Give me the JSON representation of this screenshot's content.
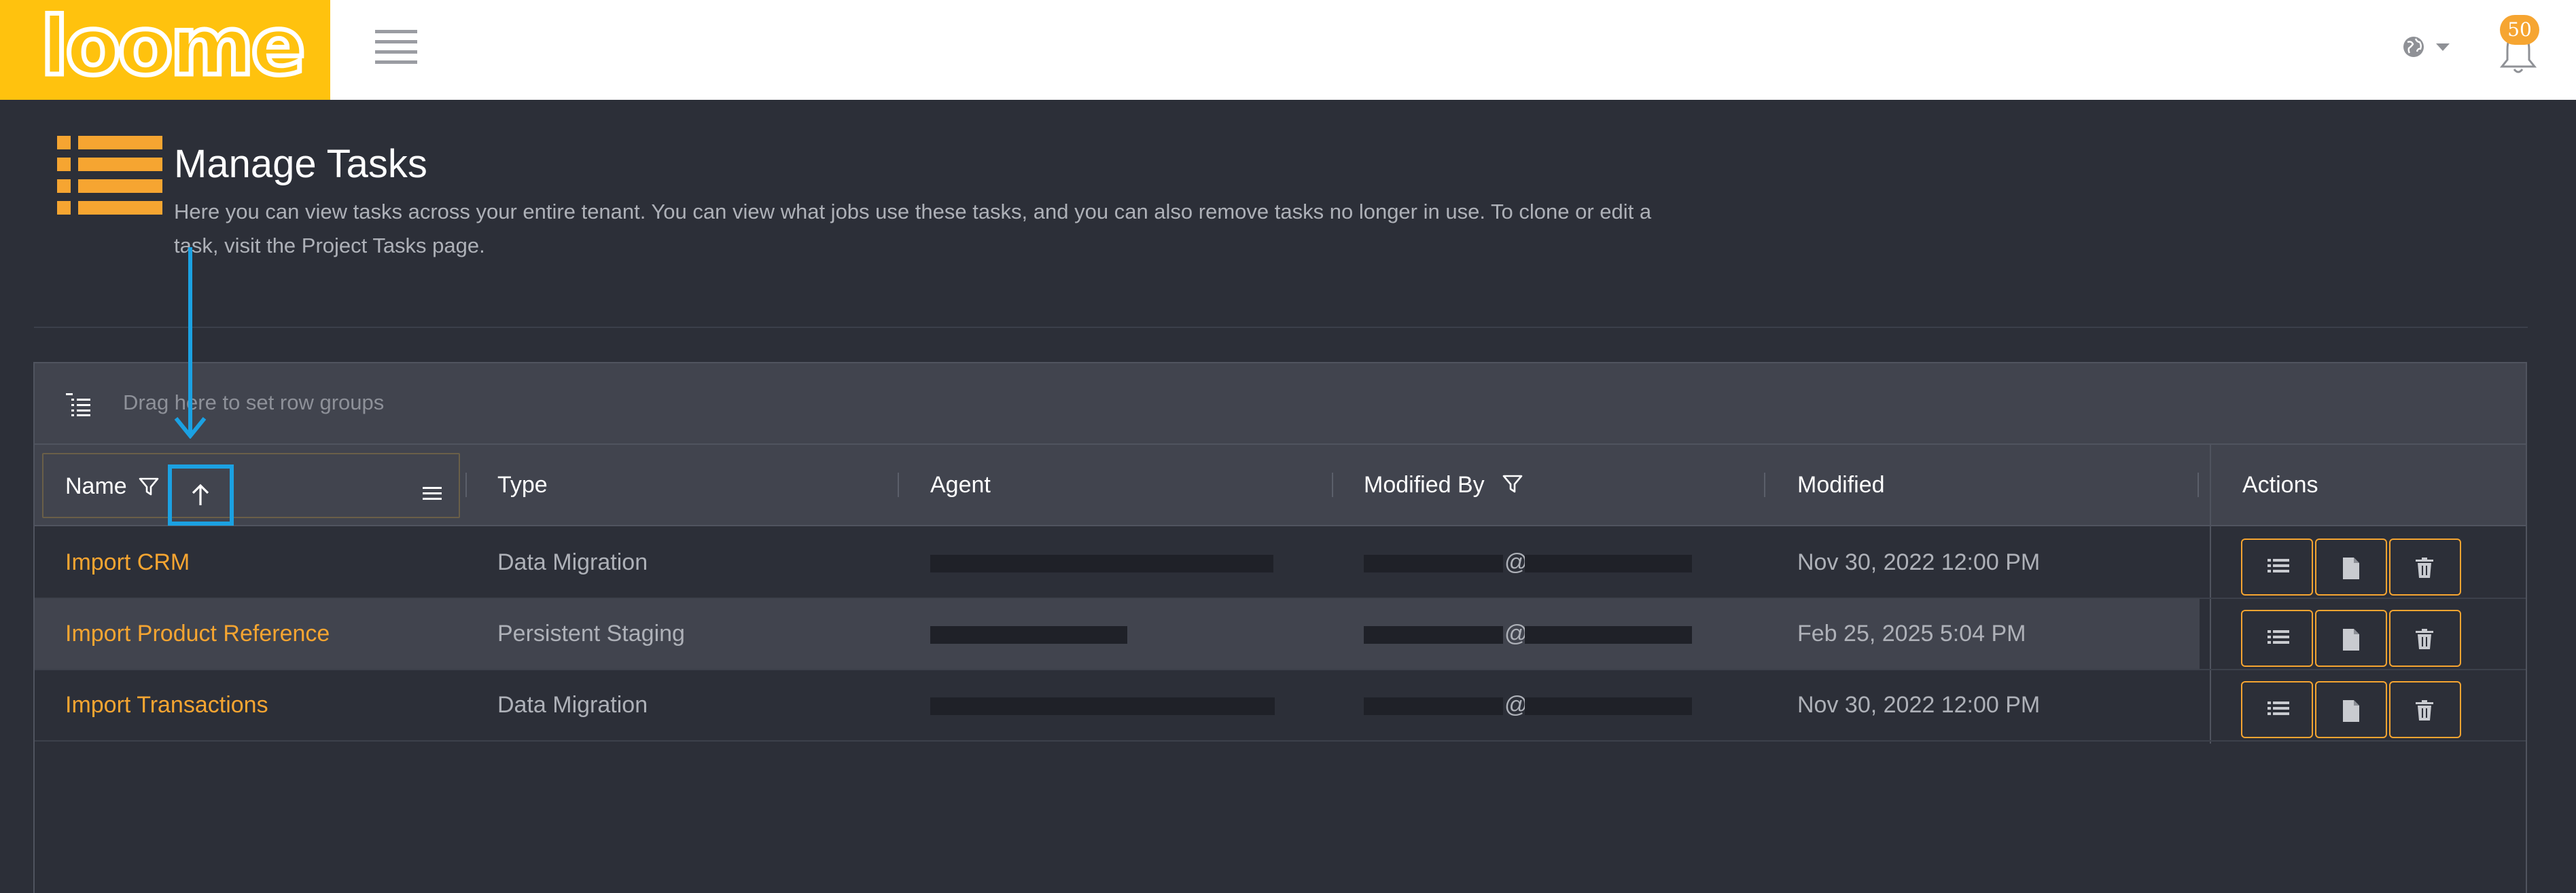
{
  "header": {
    "logo_text": "loome",
    "notification_count": "50"
  },
  "page": {
    "title": "Manage Tasks",
    "description": "Here you can view tasks across your entire tenant. You can view what jobs use these tasks, and you can also remove tasks no longer in use. To clone or edit a task, visit the Project Tasks page."
  },
  "grid": {
    "group_panel_placeholder": "Drag here to set row groups",
    "columns": {
      "name": "Name",
      "type": "Type",
      "agent": "Agent",
      "modified_by": "Modified By",
      "modified": "Modified",
      "actions": "Actions"
    },
    "sort": {
      "column": "Name",
      "direction": "ascending"
    },
    "rows": [
      {
        "name": "Import CRM",
        "type": "Data Migration",
        "modified_by_at": "@",
        "modified": "Nov 30, 2022 12:00 PM"
      },
      {
        "name": "Import Product Reference",
        "type": "Persistent Staging",
        "modified_by_at": "@",
        "modified": "Feb 25, 2025 5:04 PM"
      },
      {
        "name": "Import Transactions",
        "type": "Data Migration",
        "modified_by_at": "@",
        "modified": "Nov 30, 2022 12:00 PM"
      }
    ],
    "row_actions": [
      "list-icon",
      "document-icon",
      "trash-icon"
    ]
  },
  "colors": {
    "brand_yellow": "#ffc20e",
    "accent_orange": "#f6a531",
    "background": "#2c2f38",
    "panel": "#41444e",
    "annotation_blue": "#1ba1e2"
  }
}
